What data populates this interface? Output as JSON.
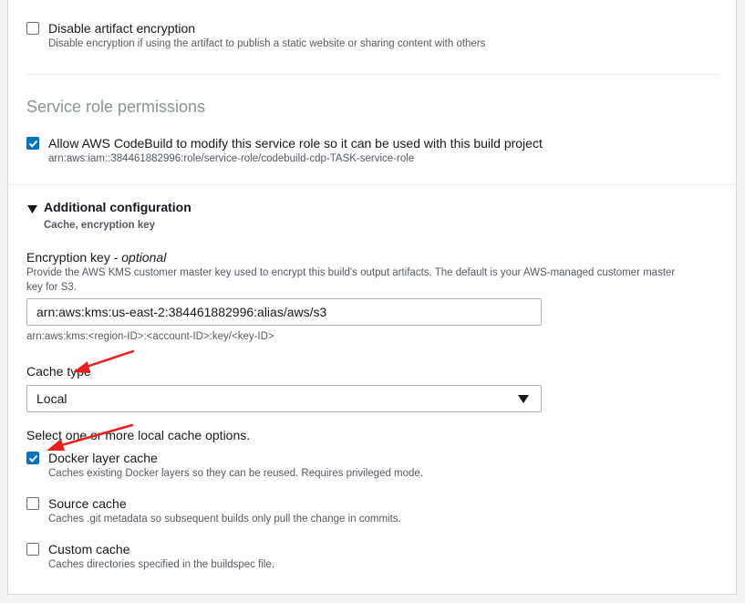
{
  "artifact_encryption": {
    "label": "Disable artifact encryption",
    "description": "Disable encryption if using the artifact to publish a static website or sharing content with others",
    "checked": false
  },
  "service_role": {
    "title": "Service role permissions",
    "label": "Allow AWS CodeBuild to modify this service role so it can be used with this build project",
    "arn": "arn:aws:iam::384461882996:role/service-role/codebuild-cdp-TASK-service-role",
    "checked": true
  },
  "additional_config": {
    "title": "Additional configuration",
    "subtitle": "Cache, encryption key"
  },
  "encryption_key": {
    "label": "Encryption key - ",
    "label_optional": "optional",
    "description_line1": "Provide the AWS KMS customer master key used to encrypt this build's output artifacts. The default is your AWS-managed customer master",
    "description_line2": "key for S3.",
    "value": "arn:aws:kms:us-east-2:384461882996:alias/aws/s3",
    "hint": "arn:aws:kms:<region-ID>:<account-ID>:key/<key-ID>"
  },
  "cache_type": {
    "label": "Cache type",
    "selected": "Local"
  },
  "local_cache": {
    "prompt": "Select one or more local cache options.",
    "options": [
      {
        "label": "Docker layer cache",
        "description": "Caches existing Docker layers so they can be reused. Requires privileged mode.",
        "checked": true
      },
      {
        "label": "Source cache",
        "description": "Caches .git metadata so subsequent builds only pull the change in commits.",
        "checked": false
      },
      {
        "label": "Custom cache",
        "description": "Caches directories specified in the buildspec file.",
        "checked": false
      }
    ]
  },
  "colors": {
    "accent": "#0073bb",
    "annotation_arrow": "#e8201c"
  },
  "icons": {
    "checkbox_check": "check-icon",
    "expand": "caret-down-icon",
    "dropdown": "caret-down-icon",
    "annotation": "red-arrow-icon"
  }
}
